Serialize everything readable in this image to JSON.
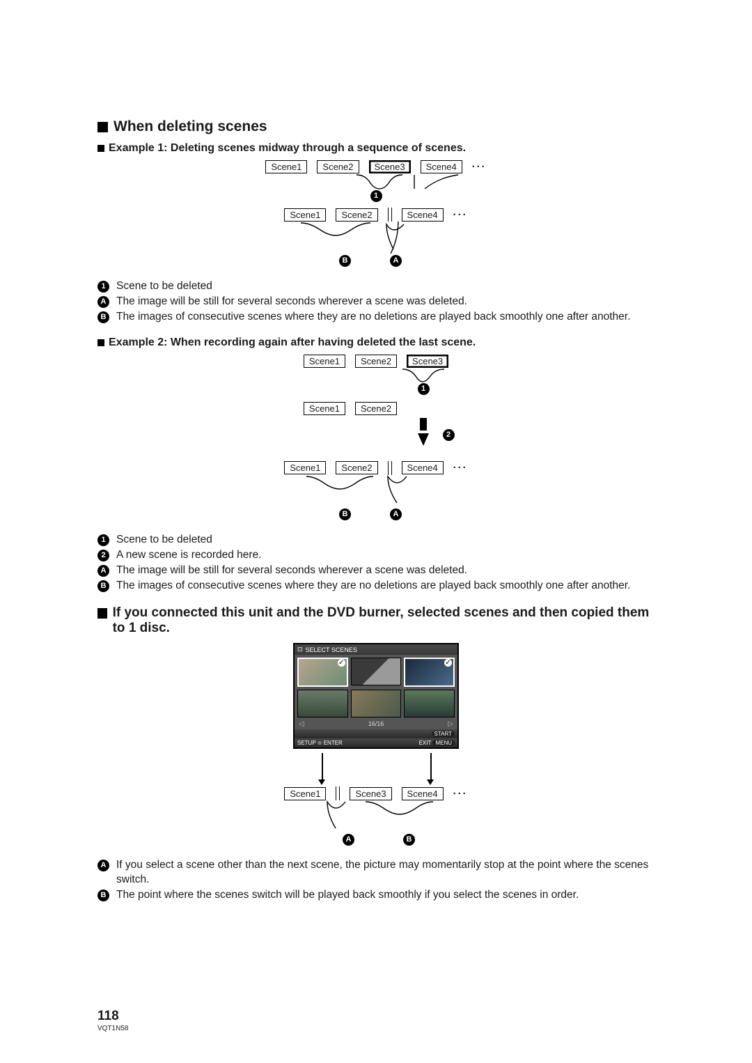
{
  "heading1": "When deleting scenes",
  "example1": "Example 1: Deleting scenes midway through a sequence of scenes.",
  "scenes": {
    "s1": "Scene1",
    "s2": "Scene2",
    "s3": "Scene3",
    "s4": "Scene4",
    "dots": "···"
  },
  "markers": {
    "m1": "1",
    "m2": "2",
    "mA": "A",
    "mB": "B"
  },
  "list1": {
    "i1": "Scene to be deleted",
    "iA": "The image will be still for several seconds wherever a scene was deleted.",
    "iB": "The images of consecutive scenes where they are no deletions are played back smoothly one after another."
  },
  "example2": "Example 2: When recording again after having deleted the last scene.",
  "list2": {
    "i1": "Scene to be deleted",
    "i2": "A new scene is recorded here.",
    "iA": "The image will be still for several seconds wherever a scene was deleted.",
    "iB": "The images of consecutive scenes where they are no deletions are played back smoothly one after another."
  },
  "heading2": "If you connected this unit and the DVD burner, selected scenes and then copied them to 1 disc.",
  "selectScreen": {
    "title": "SELECT SCENES",
    "counter": "16/16",
    "start": "START",
    "setup": "SETUP",
    "enter": "ENTER",
    "exit": "EXIT",
    "menu": "MENU"
  },
  "list3": {
    "iA": "If you select a scene other than the next scene, the picture may momentarily stop at the point where the scenes switch.",
    "iB": "The point where the scenes switch will be played back smoothly if you select the scenes in order."
  },
  "pageNumber": "118",
  "docId": "VQT1N58",
  "navArrows": {
    "left": "◁",
    "right": "▷"
  }
}
